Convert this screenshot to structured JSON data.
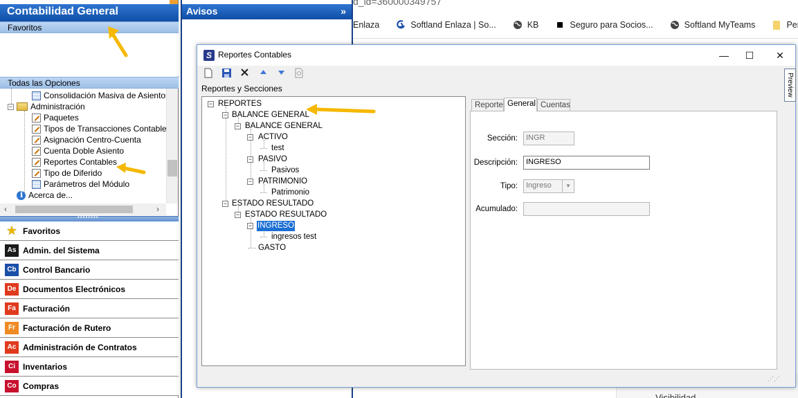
{
  "browser": {
    "url_fragment": "d_id=360000349757",
    "bookmarks": [
      {
        "label": "Enlaza",
        "icon": "none"
      },
      {
        "label": "Softland Enlaza | So...",
        "icon": "softland-icon"
      },
      {
        "label": "KB",
        "icon": "globe-icon"
      },
      {
        "label": "Seguro para Socios...",
        "icon": "square-icon"
      },
      {
        "label": "Softland MyTeams",
        "icon": "globe-icon"
      },
      {
        "label": "Personal",
        "icon": "folder-icon"
      }
    ],
    "bottom_text": "Visibilidad"
  },
  "left_panel": {
    "title": "Contabilidad General",
    "favorites_header": "Favoritos",
    "all_options_header": "Todas las Opciones",
    "tree": [
      {
        "label": "Consolidación Masiva de Asientos",
        "icon": "grid-icon"
      },
      {
        "label": "Administración",
        "icon": "folder-icon"
      },
      {
        "label": "Paquetes",
        "icon": "pencil-icon"
      },
      {
        "label": "Tipos de Transacciones Contable",
        "icon": "pencil-icon"
      },
      {
        "label": "Asignación Centro-Cuenta",
        "icon": "pencil-icon"
      },
      {
        "label": "Cuenta Doble Asiento",
        "icon": "pencil-icon"
      },
      {
        "label": "Reportes Contables",
        "icon": "pencil-icon"
      },
      {
        "label": "Tipo de Diferido",
        "icon": "pencil-icon"
      },
      {
        "label": "Parámetros del Módulo",
        "icon": "grid-icon"
      },
      {
        "label": "Acerca de...",
        "icon": "info-icon"
      }
    ],
    "modules": [
      {
        "label": "Favoritos",
        "badge": "",
        "color": "#e8b800"
      },
      {
        "label": "Admin. del Sistema",
        "badge": "As",
        "color": "#1a1a1a"
      },
      {
        "label": "Control Bancario",
        "badge": "Cb",
        "color": "#1b4fa8"
      },
      {
        "label": "Documentos Electrónicos",
        "badge": "De",
        "color": "#e03a1e"
      },
      {
        "label": "Facturación",
        "badge": "Fa",
        "color": "#e03a1e"
      },
      {
        "label": "Facturación de Rutero",
        "badge": "Fr",
        "color": "#f08a24"
      },
      {
        "label": "Administración de Contratos",
        "badge": "Ac",
        "color": "#e03a1e"
      },
      {
        "label": "Inventarios",
        "badge": "Ci",
        "color": "#c8102e"
      },
      {
        "label": "Compras",
        "badge": "Co",
        "color": "#c8102e"
      }
    ]
  },
  "avisos": {
    "title": "Avisos",
    "collapse_glyph": "»"
  },
  "dialog": {
    "title": "Reportes Contables",
    "section_label": "Reportes y Secciones",
    "preview_label": "Preview",
    "tree": {
      "root": "REPORTES",
      "nodes": [
        {
          "label": "BALANCE GENERAL",
          "level": 1
        },
        {
          "label": "BALANCE GENERAL",
          "level": 2
        },
        {
          "label": "ACTIVO",
          "level": 3
        },
        {
          "label": "test",
          "level": 4
        },
        {
          "label": "PASIVO",
          "level": 3
        },
        {
          "label": "Pasivos",
          "level": 4
        },
        {
          "label": "PATRIMONIO",
          "level": 3
        },
        {
          "label": "Patrimonio",
          "level": 4
        },
        {
          "label": "ESTADO RESULTADO",
          "level": 1
        },
        {
          "label": "ESTADO RESULTADO",
          "level": 2
        },
        {
          "label": "INGRESO",
          "level": 3,
          "selected": true
        },
        {
          "label": "ingresos test",
          "level": 4
        },
        {
          "label": "GASTO",
          "level": 3
        }
      ]
    },
    "tabs": [
      "Reporte",
      "General",
      "Cuentas"
    ],
    "active_tab": "General",
    "form": {
      "seccion_label": "Sección:",
      "seccion_value": "INGR",
      "descripcion_label": "Descripción:",
      "descripcion_value": "INGRESO",
      "tipo_label": "Tipo:",
      "tipo_value": "Ingreso",
      "acumulado_label": "Acumulado:",
      "acumulado_value": ""
    }
  },
  "colors": {
    "header_blue": "#0f4ea6",
    "selection_blue": "#1c6fd4",
    "arrow_orange": "#f5b800"
  }
}
